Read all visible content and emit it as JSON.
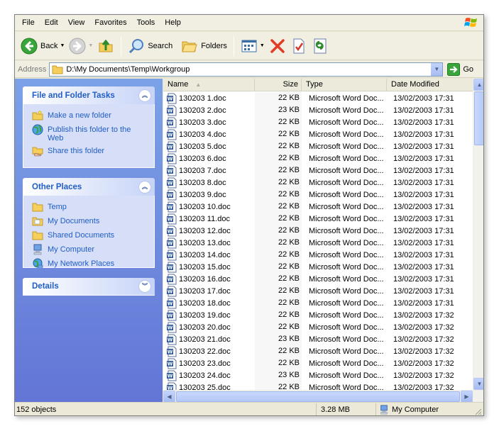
{
  "menu": [
    "File",
    "Edit",
    "View",
    "Favorites",
    "Tools",
    "Help"
  ],
  "toolbar": {
    "back_label": "Back",
    "search_label": "Search",
    "folders_label": "Folders"
  },
  "address": {
    "label": "Address",
    "value": "D:\\My Documents\\Temp\\Workgroup",
    "go_label": "Go"
  },
  "left_pane": {
    "file_tasks": {
      "title": "File and Folder Tasks",
      "items": [
        "Make a new folder",
        "Publish this folder to the Web",
        "Share this folder"
      ]
    },
    "other_places": {
      "title": "Other Places",
      "items": [
        "Temp",
        "My Documents",
        "Shared Documents",
        "My Computer",
        "My Network Places"
      ]
    },
    "details": {
      "title": "Details"
    }
  },
  "columns": {
    "name": "Name",
    "size": "Size",
    "type": "Type",
    "date": "Date Modified"
  },
  "files": [
    {
      "name": "130203 1.doc",
      "size": "22 KB",
      "type": "Microsoft Word Doc...",
      "date": "13/02/2003 17:31"
    },
    {
      "name": "130203 2.doc",
      "size": "23 KB",
      "type": "Microsoft Word Doc...",
      "date": "13/02/2003 17:31"
    },
    {
      "name": "130203 3.doc",
      "size": "22 KB",
      "type": "Microsoft Word Doc...",
      "date": "13/02/2003 17:31"
    },
    {
      "name": "130203 4.doc",
      "size": "22 KB",
      "type": "Microsoft Word Doc...",
      "date": "13/02/2003 17:31"
    },
    {
      "name": "130203 5.doc",
      "size": "22 KB",
      "type": "Microsoft Word Doc...",
      "date": "13/02/2003 17:31"
    },
    {
      "name": "130203 6.doc",
      "size": "22 KB",
      "type": "Microsoft Word Doc...",
      "date": "13/02/2003 17:31"
    },
    {
      "name": "130203 7.doc",
      "size": "22 KB",
      "type": "Microsoft Word Doc...",
      "date": "13/02/2003 17:31"
    },
    {
      "name": "130203 8.doc",
      "size": "22 KB",
      "type": "Microsoft Word Doc...",
      "date": "13/02/2003 17:31"
    },
    {
      "name": "130203 9.doc",
      "size": "22 KB",
      "type": "Microsoft Word Doc...",
      "date": "13/02/2003 17:31"
    },
    {
      "name": "130203 10.doc",
      "size": "22 KB",
      "type": "Microsoft Word Doc...",
      "date": "13/02/2003 17:31"
    },
    {
      "name": "130203 11.doc",
      "size": "22 KB",
      "type": "Microsoft Word Doc...",
      "date": "13/02/2003 17:31"
    },
    {
      "name": "130203 12.doc",
      "size": "22 KB",
      "type": "Microsoft Word Doc...",
      "date": "13/02/2003 17:31"
    },
    {
      "name": "130203 13.doc",
      "size": "22 KB",
      "type": "Microsoft Word Doc...",
      "date": "13/02/2003 17:31"
    },
    {
      "name": "130203 14.doc",
      "size": "22 KB",
      "type": "Microsoft Word Doc...",
      "date": "13/02/2003 17:31"
    },
    {
      "name": "130203 15.doc",
      "size": "22 KB",
      "type": "Microsoft Word Doc...",
      "date": "13/02/2003 17:31"
    },
    {
      "name": "130203 16.doc",
      "size": "22 KB",
      "type": "Microsoft Word Doc...",
      "date": "13/02/2003 17:31"
    },
    {
      "name": "130203 17.doc",
      "size": "22 KB",
      "type": "Microsoft Word Doc...",
      "date": "13/02/2003 17:31"
    },
    {
      "name": "130203 18.doc",
      "size": "22 KB",
      "type": "Microsoft Word Doc...",
      "date": "13/02/2003 17:31"
    },
    {
      "name": "130203 19.doc",
      "size": "22 KB",
      "type": "Microsoft Word Doc...",
      "date": "13/02/2003 17:32"
    },
    {
      "name": "130203 20.doc",
      "size": "22 KB",
      "type": "Microsoft Word Doc...",
      "date": "13/02/2003 17:32"
    },
    {
      "name": "130203 21.doc",
      "size": "23 KB",
      "type": "Microsoft Word Doc...",
      "date": "13/02/2003 17:32"
    },
    {
      "name": "130203 22.doc",
      "size": "22 KB",
      "type": "Microsoft Word Doc...",
      "date": "13/02/2003 17:32"
    },
    {
      "name": "130203 23.doc",
      "size": "22 KB",
      "type": "Microsoft Word Doc...",
      "date": "13/02/2003 17:32"
    },
    {
      "name": "130203 24.doc",
      "size": "23 KB",
      "type": "Microsoft Word Doc...",
      "date": "13/02/2003 17:32"
    },
    {
      "name": "130203 25.doc",
      "size": "22 KB",
      "type": "Microsoft Word Doc...",
      "date": "13/02/2003 17:32"
    }
  ],
  "status": {
    "objects": "152 objects",
    "size": "3.28 MB",
    "location": "My Computer"
  },
  "colors": {
    "task_pane_top": "#7ba2e7",
    "task_pane_bottom": "#6375d6",
    "link_blue": "#215dc6",
    "chrome": "#ece9d8"
  },
  "icons": {
    "back": "back-arrow-icon",
    "forward": "forward-arrow-icon",
    "up": "up-folder-icon",
    "search": "search-icon",
    "folders": "folders-icon",
    "views": "views-icon",
    "delete": "delete-icon",
    "properties": "properties-icon",
    "undo": "undo-icon",
    "file": "word-document-icon"
  }
}
